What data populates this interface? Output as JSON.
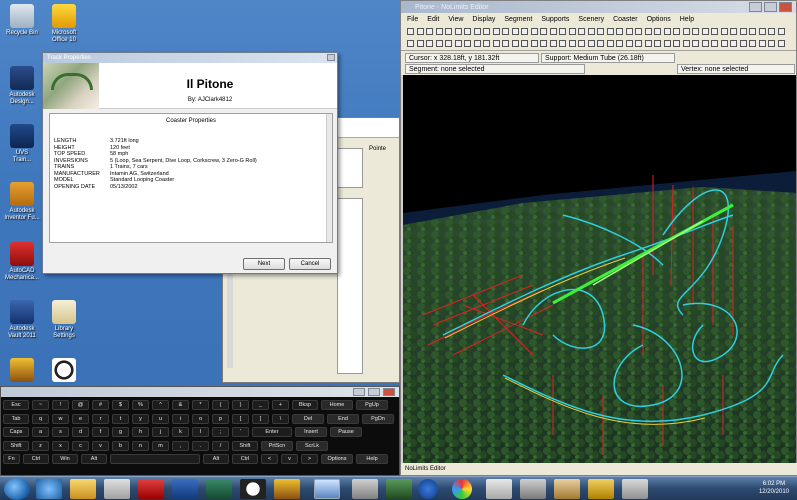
{
  "desktop": {
    "icons": [
      {
        "label_1": "Recycle Bin",
        "label_2": ""
      },
      {
        "label_1": "Microsoft",
        "label_2": "Office 10"
      },
      {
        "label_1": "Autodesk",
        "label_2": "Design..."
      },
      {
        "label_1": "UVS",
        "label_2": "Train..."
      },
      {
        "label_1": "Autodesk",
        "label_2": "Inventor Fu..."
      },
      {
        "label_1": "AutoCAD",
        "label_2": "Mechanica..."
      },
      {
        "label_1": "Autodesk",
        "label_2": "Vault 2011"
      },
      {
        "label_1": "Library",
        "label_2": "Settings"
      },
      {
        "label_1": "",
        "label_2": ""
      },
      {
        "label_1": "",
        "label_2": ""
      }
    ]
  },
  "editor": {
    "title": "Pitone - NoLimits Editor",
    "menu": [
      "File",
      "Edit",
      "View",
      "Display",
      "Segment",
      "Supports",
      "Scenery",
      "Coaster",
      "Options",
      "Help"
    ],
    "cursor_text": "Cursor: x 328.18ft, y 181.32ft",
    "support_text": "Support: Medium Tube (26.18ft)",
    "segment_text": "Segment: none selected",
    "vertex_text": "Vertex: none selected",
    "footer": "NoLimits Editor"
  },
  "dialog": {
    "window_title": "Track Properties",
    "coaster_name": "Il Pitone",
    "author_line": "By: AJClark4812",
    "caption": "Coaster Properties",
    "properties": [
      {
        "key": "LENGTH",
        "value": "3.721ft long"
      },
      {
        "key": "HEIGHT",
        "value": "120 feet"
      },
      {
        "key": "TOP SPEED",
        "value": "58 mph"
      },
      {
        "key": "INVERSIONS",
        "value": "5 (Loop, Sea Serpent, Dive Loop, Corkscrew, 3 Zero-G Roll)"
      },
      {
        "key": "TRAINS",
        "value": "1 Trains, 7 cars"
      },
      {
        "key": "MANUFACTURER",
        "value": "Intamin AG, Switzerland"
      },
      {
        "key": "MODEL",
        "value": "Standard Looping Coaster"
      },
      {
        "key": "OPENING DATE",
        "value": "05/13/2002"
      }
    ],
    "next_label": "Next",
    "cancel_label": "Cancel"
  },
  "panel": {
    "label": "Pointe"
  },
  "keyboard": {
    "rows": [
      [
        "Esc",
        "~",
        "!",
        "@",
        "#",
        "$",
        "%",
        "^",
        "&",
        "*",
        "(",
        ")",
        "_",
        "+",
        "Bksp",
        "Home",
        "PgUp"
      ],
      [
        "Tab",
        "q",
        "w",
        "e",
        "r",
        "t",
        "y",
        "u",
        "i",
        "o",
        "p",
        "[",
        "]",
        "\\",
        "Del",
        "End",
        "PgDn"
      ],
      [
        "Caps",
        "a",
        "s",
        "d",
        "f",
        "g",
        "h",
        "j",
        "k",
        "l",
        ";",
        "'",
        "Enter",
        "Insert",
        "Pause"
      ],
      [
        "Shift",
        "z",
        "x",
        "c",
        "v",
        "b",
        "n",
        "m",
        ",",
        ".",
        "/",
        "Shift",
        "PrtScn",
        "ScrLk"
      ],
      [
        "Fn",
        "Ctrl",
        "Win",
        "Alt",
        "",
        "Alt",
        "Ctrl",
        "<",
        "v",
        ">",
        "Options",
        "Help"
      ]
    ]
  },
  "taskbar": {
    "time": "6:02 PM",
    "date": "12/20/2010"
  }
}
